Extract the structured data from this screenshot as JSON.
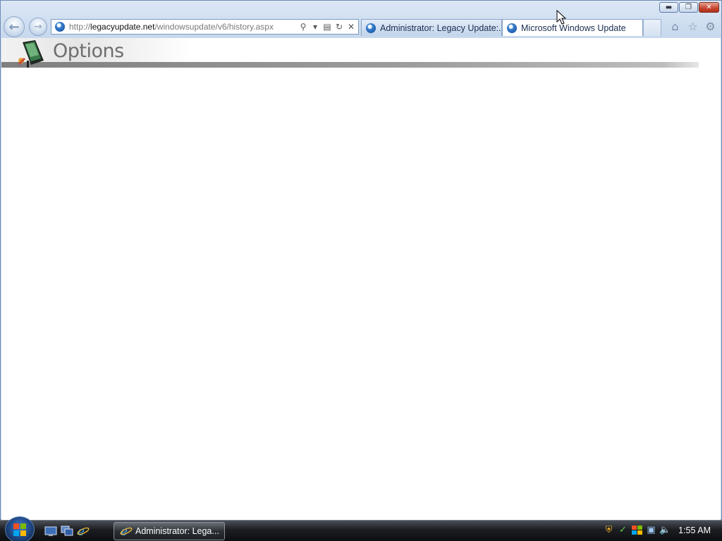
{
  "browser": {
    "address": {
      "url_prefix": "http://",
      "url_domain": "legacyupdate.net",
      "url_path": "/windowsupdate/v6/history.aspx"
    },
    "tabs": [
      {
        "label": "Administrator: Legacy Update:...",
        "active": false
      },
      {
        "label": "Microsoft Windows Update",
        "active": true
      }
    ],
    "icons": {
      "back": "back-arrow-icon",
      "forward": "forward-arrow-icon",
      "home": "home-icon",
      "favorites": "star-icon",
      "tools": "gear-icon"
    }
  },
  "page": {
    "title": "Options"
  },
  "taskbar": {
    "task_button_label": "Administrator: Lega...",
    "clock": "1:55 AM"
  },
  "colors": {
    "header_bar": "#8f8f8f",
    "title_text": "#6e6e6e",
    "taskbar_bg": "#1b1d21"
  }
}
